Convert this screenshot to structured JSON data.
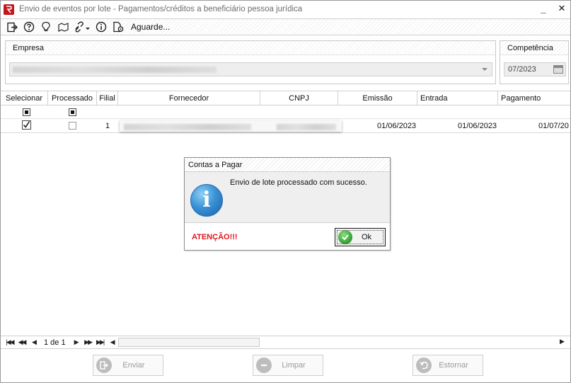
{
  "window": {
    "title": "Envio de eventos por lote - Pagamentos/créditos a beneficiário pessoa jurídica",
    "minimize_label": "_",
    "close_label": "✕"
  },
  "toolbar": {
    "status_label": "Aguarde..."
  },
  "empresa": {
    "title": "Empresa",
    "value": "Empresa (redigido)"
  },
  "competencia": {
    "title": "Competência",
    "value": "07/2023"
  },
  "grid": {
    "columns": [
      "Selecionar",
      "Processado",
      "Filial",
      "Fornecedor",
      "CNPJ",
      "Emissão",
      "Entrada",
      "Pagamento"
    ],
    "rows": [
      {
        "filial": "1",
        "fornecedor": "Fornecedor (redigido)",
        "cnpj": "CNPJ (redigido)",
        "emissao": "01/06/2023",
        "entrada": "01/06/2023",
        "pagamento": "01/07/20"
      }
    ]
  },
  "pager": {
    "page_text": "1 de 1"
  },
  "footer": {
    "send_label": "Enviar",
    "clear_label": "Limpar",
    "reverse_label": "Estornar"
  },
  "dialog": {
    "title": "Contas a Pagar",
    "message": "Envio de lote processado com sucesso.",
    "warning": "ATENÇÃO!!!",
    "ok_label": "Ok",
    "icon_glyph": "i"
  },
  "colors": {
    "warning": "#e0141c",
    "app_icon": "#c4161c",
    "info_icon": "#3a93d6",
    "ok_icon": "#3aa33a"
  }
}
